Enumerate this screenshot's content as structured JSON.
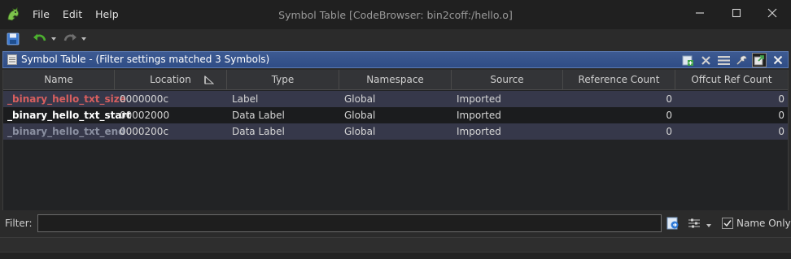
{
  "window": {
    "title": "Symbol Table [CodeBrowser: bin2coff:/hello.o]",
    "minimize": "—",
    "maximize": "□",
    "close": "✕"
  },
  "menu": [
    "File",
    "Edit",
    "Help"
  ],
  "toolbar": {
    "save_icon": "save-icon",
    "undo_icon": "undo-icon",
    "redo_icon": "redo-icon"
  },
  "panel": {
    "title": "Symbol Table - (Filter settings matched 3 Symbols)",
    "buttons": [
      "add-icon",
      "delete-icon",
      "menu-icon",
      "settings-icon",
      "export-icon",
      "close-icon"
    ]
  },
  "table": {
    "columns": [
      "Name",
      "Location",
      "Type",
      "Namespace",
      "Source",
      "Reference Count",
      "Offcut Ref Count"
    ],
    "rows": [
      {
        "name": "_binary_hello_txt_size",
        "location": "0000000c",
        "type": "Label",
        "namespace": "Global",
        "source": "Imported",
        "ref_count": "0",
        "offcut": "0"
      },
      {
        "name": "_binary_hello_txt_start",
        "location": "00002000",
        "type": "Data Label",
        "namespace": "Global",
        "source": "Imported",
        "ref_count": "0",
        "offcut": "0"
      },
      {
        "name": "_binary_hello_txt_end",
        "location": "0000200c",
        "type": "Data Label",
        "namespace": "Global",
        "source": "Imported",
        "ref_count": "0",
        "offcut": "0"
      }
    ]
  },
  "filter": {
    "label": "Filter:",
    "value": "",
    "name_only_label": "Name Only",
    "name_only_checked": true
  },
  "colors": {
    "row_selected": "#36384a",
    "row_normal": "#1b1c1e",
    "name_red": "#d75f5f",
    "name_white": "#ffffff",
    "name_gray": "#8a8fa0"
  }
}
